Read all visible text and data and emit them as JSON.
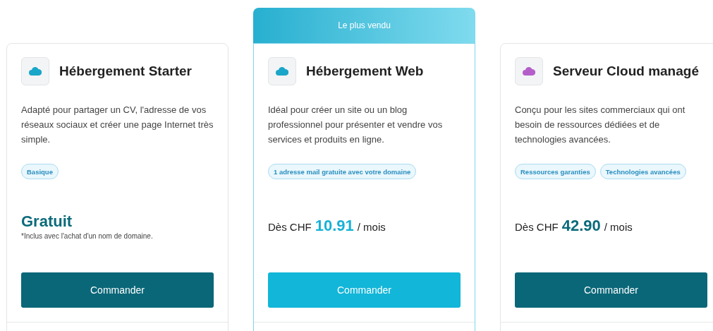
{
  "plans": [
    {
      "title": "Hébergement Starter",
      "highlighted": false,
      "color": "#1aa6c8",
      "description": "Adapté pour partager un CV, l'adresse de vos réseaux sociaux et créer une page Internet très simple.",
      "tags": [
        "Basique"
      ],
      "price": {
        "kind": "free",
        "amount": "Gratuit",
        "note": "*Inclus avec l'achat d'un nom de domaine."
      },
      "button": "Commander"
    },
    {
      "banner": "Le plus vendu",
      "title": "Hébergement Web",
      "highlighted": true,
      "color": "#1aa6c8",
      "description": "Idéal pour créer un site ou un blog professionnel pour présenter et vendre vos services et produits en ligne.",
      "tags": [
        "1 adresse mail gratuite avec votre domaine"
      ],
      "price": {
        "kind": "from",
        "prefix": "Dès CHF",
        "amount": "10.91",
        "suffix": "/ mois"
      },
      "button": "Commander"
    },
    {
      "title": "Serveur Cloud managé",
      "highlighted": false,
      "color": "#b45fc9",
      "description": "Conçu pour les sites commerciaux qui ont besoin de ressources dédiées et de technologies avancées.",
      "tags": [
        "Ressources garanties",
        "Technologies avancées"
      ],
      "price": {
        "kind": "from",
        "prefix": "Dès CHF",
        "amount": "42.90",
        "suffix": "/ mois"
      },
      "button": "Commander"
    }
  ]
}
